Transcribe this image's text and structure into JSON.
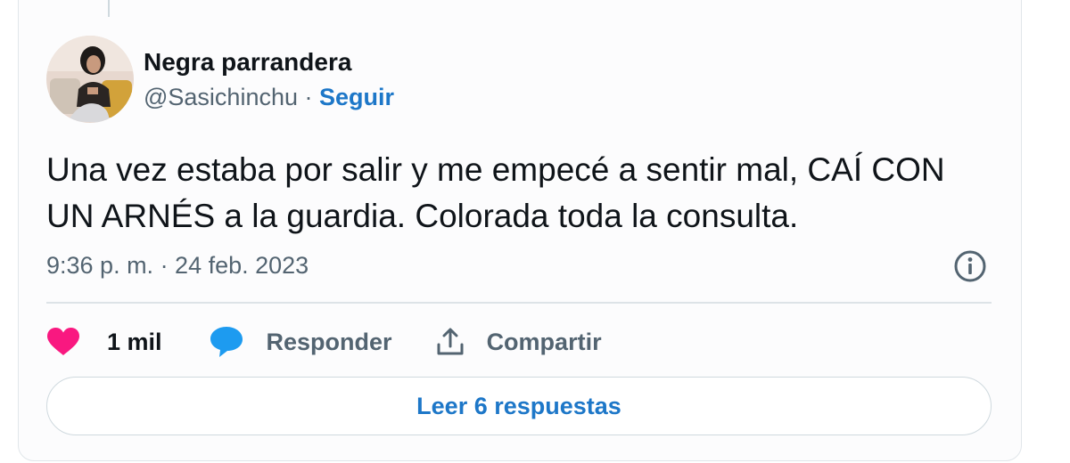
{
  "tweet": {
    "author_name": "Negra parrandera",
    "handle": "@Sasichinchu",
    "separator": "·",
    "follow_label": "Seguir",
    "text": "Una vez estaba por salir y me empecé a sentir mal, CAÍ CON UN ARNÉS a la guardia. Colorada toda la consulta.",
    "timestamp": "9:36 p. m. · 24 feb. 2023"
  },
  "actions": {
    "like_count": "1 mil",
    "reply_label": "Responder",
    "share_label": "Compartir"
  },
  "read_replies_label": "Leer 6 respuestas",
  "icons": {
    "like": "heart-icon",
    "reply": "speech-bubble-icon",
    "share": "share-upload-icon",
    "info": "info-icon"
  },
  "colors": {
    "link": "#1d77c8",
    "heart": "#f91880",
    "reply_bubble": "#1d9bf0",
    "secondary_text": "#536471"
  }
}
